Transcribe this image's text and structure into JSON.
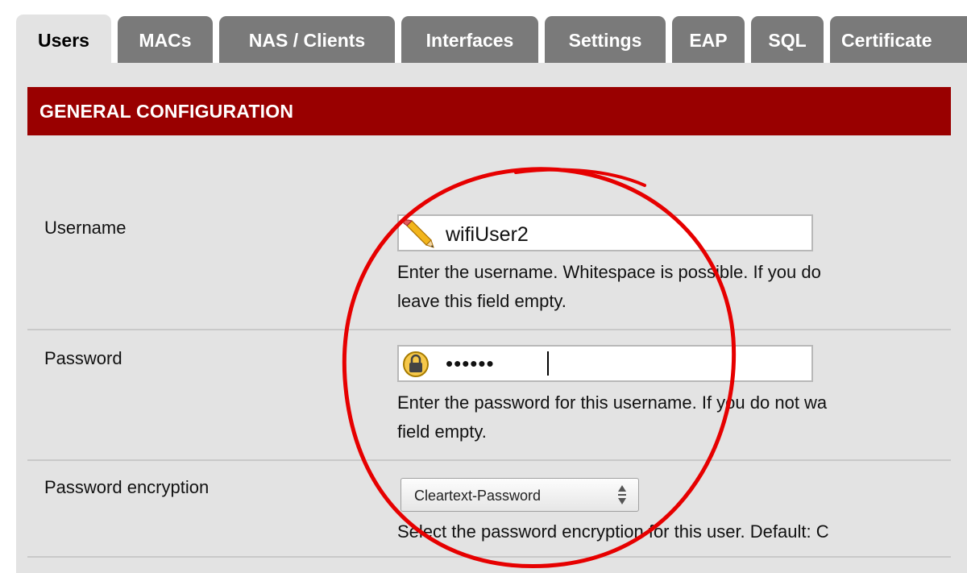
{
  "tabs": [
    {
      "label": "Users",
      "active": true
    },
    {
      "label": "MACs",
      "active": false
    },
    {
      "label": "NAS / Clients",
      "active": false
    },
    {
      "label": "Interfaces",
      "active": false
    },
    {
      "label": "Settings",
      "active": false
    },
    {
      "label": "EAP",
      "active": false
    },
    {
      "label": "SQL",
      "active": false
    },
    {
      "label": "Certificate",
      "active": false
    }
  ],
  "section": {
    "title": "GENERAL CONFIGURATION"
  },
  "username": {
    "label": "Username",
    "value": "wifiUser2",
    "help_line1": "Enter the username. Whitespace is possible. If you do",
    "help_line2": "leave this field empty.",
    "icon": "pencil-icon"
  },
  "password": {
    "label": "Password",
    "value": "••••••",
    "help_line1": "Enter the password for this username. If you do not wa",
    "help_line2": "field empty.",
    "icon": "lock-icon"
  },
  "encryption": {
    "label": "Password encryption",
    "selected": "Cleartext-Password",
    "help_line1": "Select the password encryption for this user. Default: C"
  },
  "colors": {
    "header_bg": "#990000",
    "panel_bg": "#e3e3e3",
    "tab_inactive_bg": "#7a7a7a",
    "annotation_circle": "#e60000"
  }
}
